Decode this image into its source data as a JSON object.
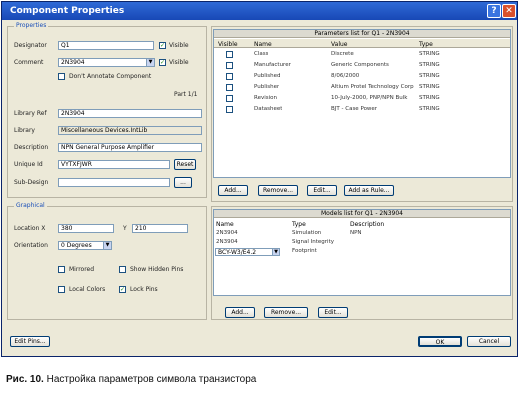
{
  "window": {
    "title": "Component Properties",
    "help_glyph": "?",
    "close_glyph": "✕"
  },
  "properties": {
    "group_title": "Properties",
    "designator_label": "Designator",
    "designator_value": "Q1",
    "visible_label": "Visible",
    "comment_label": "Comment",
    "comment_value": "2N3904",
    "visible2_label": "Visible",
    "dont_annotate_label": "Don't Annotate Component",
    "part_label": "Part 1/1",
    "library_ref_label": "Library Ref",
    "library_ref_value": "2N3904",
    "library_label": "Library",
    "library_value": "Miscellaneous Devices.IntLib",
    "description_label": "Description",
    "description_value": "NPN General Purpose Amplifier",
    "unique_id_label": "Unique Id",
    "unique_id_value": "VYTXFJWR",
    "reset_button": "Reset",
    "subdesign_label": "Sub-Design",
    "subdesign_button": "..."
  },
  "graphical": {
    "group_title": "Graphical",
    "location_x_label": "Location X",
    "location_x_value": "380",
    "location_y_label": "Y",
    "location_y_value": "210",
    "orientation_label": "Orientation",
    "orientation_value": "0 Degrees",
    "mirrored_label": "Mirrored",
    "show_hidden_pins_label": "Show Hidden Pins",
    "local_colors_label": "Local Colors",
    "lock_pins_label": "Lock Pins"
  },
  "parameters": {
    "title": "Parameters list for Q1 - 2N3904",
    "columns": [
      "Visible",
      "Name",
      "Value",
      "Type"
    ],
    "rows": [
      {
        "name": "Class",
        "value": "Discrete",
        "type": "STRING"
      },
      {
        "name": "Manufacturer",
        "value": "Generic Components",
        "type": "STRING"
      },
      {
        "name": "Published",
        "value": "8/06/2000",
        "type": "STRING"
      },
      {
        "name": "Publisher",
        "value": "Altium Protel Technology Corp",
        "type": "STRING"
      },
      {
        "name": "Revision",
        "value": "10-July-2000, PNP/NPN Bulk",
        "type": "STRING"
      },
      {
        "name": "Datasheet",
        "value": "BJT - Case Power",
        "type": "STRING"
      }
    ],
    "buttons": [
      "Add...",
      "Remove...",
      "Edit...",
      "Add as Rule..."
    ]
  },
  "models": {
    "title": "Models list for Q1 - 2N3904",
    "columns": [
      "Name",
      "Type",
      "Description"
    ],
    "rows": [
      {
        "name": "2N3904",
        "type": "Simulation",
        "description": "NPN"
      },
      {
        "name": "2N3904",
        "type": "Signal Integrity",
        "description": ""
      },
      {
        "name": "BCY-W3/E4.2",
        "type": "Footprint",
        "description": ""
      }
    ],
    "buttons": [
      "Add...",
      "Remove...",
      "Edit..."
    ]
  },
  "footer": {
    "edit_pins": "Edit Pins...",
    "ok": "OK",
    "cancel": "Cancel"
  },
  "caption": {
    "label": "Рис. 10.",
    "text": "Настройка параметров символа транзистора"
  }
}
